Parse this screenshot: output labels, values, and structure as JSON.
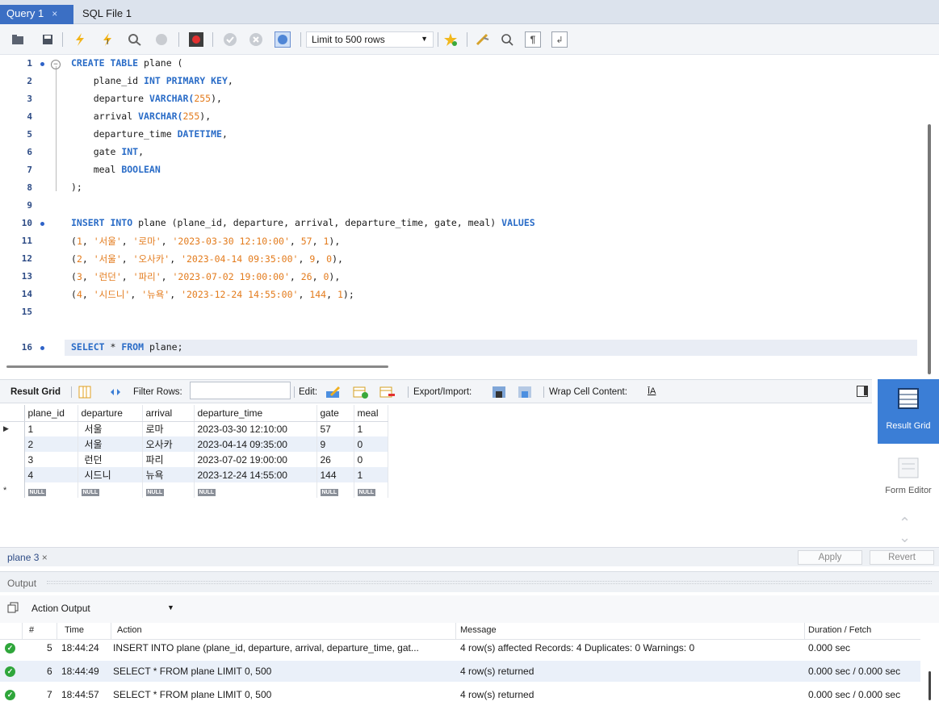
{
  "tabs": [
    {
      "label": "Query 1",
      "close": "×",
      "active": true
    },
    {
      "label": "SQL File 1",
      "active": false
    }
  ],
  "toolbar": {
    "limit_label": "Limit to 500 rows"
  },
  "editor": {
    "lines": [
      {
        "n": "1"
      },
      {
        "n": "2"
      },
      {
        "n": "3"
      },
      {
        "n": "4"
      },
      {
        "n": "5"
      },
      {
        "n": "6"
      },
      {
        "n": "7"
      },
      {
        "n": "8"
      },
      {
        "n": "9"
      },
      {
        "n": "10"
      },
      {
        "n": "11"
      },
      {
        "n": "12"
      },
      {
        "n": "13"
      },
      {
        "n": "14"
      },
      {
        "n": "15"
      },
      {
        "n": "16"
      }
    ],
    "code": {
      "l1a": "CREATE TABLE",
      "l1b": " plane (",
      "l2a": "    plane_id ",
      "l2b": "INT PRIMARY KEY",
      "l2c": ",",
      "l3a": "    departure ",
      "l3b": "VARCHAR(",
      "l3c": "255",
      "l3d": "),",
      "l4a": "    arrival ",
      "l4b": "VARCHAR(",
      "l4c": "255",
      "l4d": "),",
      "l5a": "    departure_time ",
      "l5b": "DATETIME",
      "l5c": ",",
      "l6a": "    gate ",
      "l6b": "INT",
      "l6c": ",",
      "l7a": "    meal ",
      "l7b": "BOOLEAN",
      "l8": ");",
      "l10a": "INSERT INTO",
      "l10b": " plane (plane_id, departure, arrival, departure_time, gate, meal) ",
      "l10c": "VALUES",
      "l11a": "(",
      "l11b": "1",
      "l11c": ", ",
      "l11d": "'서울'",
      "l11e": ", ",
      "l11f": "'로마'",
      "l11g": ", ",
      "l11h": "'2023-03-30 12:10:00'",
      "l11i": ", ",
      "l11j": "57",
      "l11k": ", ",
      "l11l": "1",
      "l11m": "),",
      "l12a": "(",
      "l12b": "2",
      "l12c": ", ",
      "l12d": "'서울'",
      "l12e": ", ",
      "l12f": "'오사카'",
      "l12g": ", ",
      "l12h": "'2023-04-14 09:35:00'",
      "l12i": ", ",
      "l12j": "9",
      "l12k": ", ",
      "l12l": "0",
      "l12m": "),",
      "l13a": "(",
      "l13b": "3",
      "l13c": ", ",
      "l13d": "'런던'",
      "l13e": ", ",
      "l13f": "'파리'",
      "l13g": ", ",
      "l13h": "'2023-07-02 19:00:00'",
      "l13i": ", ",
      "l13j": "26",
      "l13k": ", ",
      "l13l": "0",
      "l13m": "),",
      "l14a": "(",
      "l14b": "4",
      "l14c": ", ",
      "l14d": "'시드니'",
      "l14e": ", ",
      "l14f": "'뉴욕'",
      "l14g": ", ",
      "l14h": "'2023-12-24 14:55:00'",
      "l14i": ", ",
      "l14j": "144",
      "l14k": ", ",
      "l14l": "1",
      "l14m": ");",
      "l16a": "SELECT",
      "l16b": " * ",
      "l16c": "FROM",
      "l16d": " plane;"
    }
  },
  "result_toolbar": {
    "result_grid": "Result Grid",
    "filter_rows": "Filter Rows:",
    "edit": "Edit:",
    "export_import": "Export/Import:",
    "wrap": "Wrap Cell Content:"
  },
  "grid": {
    "columns": [
      "plane_id",
      "departure",
      "arrival",
      "departure_time",
      "gate",
      "meal"
    ],
    "rows": [
      [
        "1",
        "서울",
        "로마",
        "2023-03-30 12:10:00",
        "57",
        "1"
      ],
      [
        "2",
        "서울",
        "오사카",
        "2023-04-14 09:35:00",
        "9",
        "0"
      ],
      [
        "3",
        "런던",
        "파리",
        "2023-07-02 19:00:00",
        "26",
        "0"
      ],
      [
        "4",
        "시드니",
        "뉴욕",
        "2023-12-24 14:55:00",
        "144",
        "1"
      ]
    ],
    "null_label": "NULL",
    "new_row_marker": "*"
  },
  "side_panel": {
    "result_grid": "Result Grid",
    "form_editor": "Form Editor"
  },
  "result_tab": {
    "label": "plane 3",
    "close": "×",
    "apply": "Apply",
    "revert": "Revert"
  },
  "output": {
    "title": "Output",
    "selector": "Action Output",
    "headers": {
      "num": "#",
      "time": "Time",
      "action": "Action",
      "message": "Message",
      "duration": "Duration / Fetch"
    },
    "rows": [
      {
        "num": "5",
        "time": "18:44:24",
        "action": "INSERT INTO plane (plane_id, departure, arrival, departure_time, gat...",
        "message": "4 row(s) affected Records: 4  Duplicates: 0  Warnings: 0",
        "duration": "0.000 sec"
      },
      {
        "num": "6",
        "time": "18:44:49",
        "action": "SELECT * FROM plane LIMIT 0, 500",
        "message": "4 row(s) returned",
        "duration": "0.000 sec / 0.000 sec"
      },
      {
        "num": "7",
        "time": "18:44:57",
        "action": "SELECT * FROM plane LIMIT 0, 500",
        "message": "4 row(s) returned",
        "duration": "0.000 sec / 0.000 sec"
      }
    ]
  },
  "colors": {
    "accent": "#3b7ed6",
    "keyword": "#2a6cc7",
    "string": "#e37b1c",
    "success": "#2fa63b"
  }
}
